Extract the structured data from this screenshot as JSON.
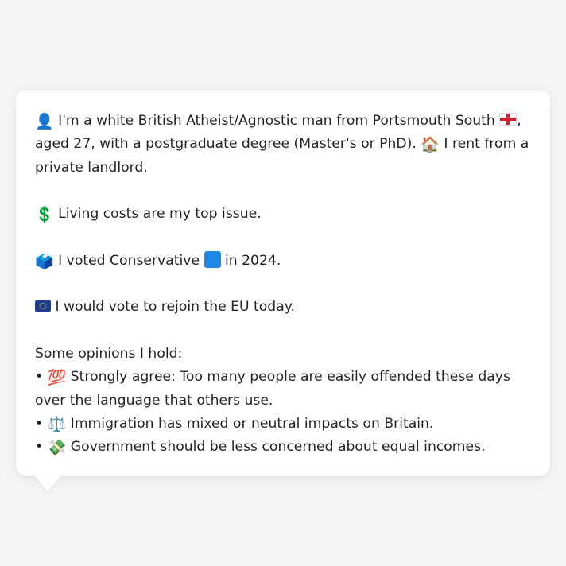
{
  "profile": {
    "line1_a": "I'm a white British Atheist/Agnostic man from Portsmouth South",
    "line1_b": ", aged 27, with a postgraduate degree (Master's or PhD).",
    "line1_c": "I rent from a private landlord.",
    "top_issue": "Living costs are my top issue.",
    "vote_a": "I voted Conservative",
    "vote_b": "in 2024.",
    "eu": "I would vote to rejoin the EU today.",
    "opinions_heading": "Some opinions I hold:",
    "opinions": [
      "Strongly agree: Too many people are easily offended these days over the language that others use.",
      "Immigration has mixed or neutral impacts on Britain.",
      "Government should be less concerned about equal incomes."
    ],
    "bullet": "•"
  },
  "icons": {
    "person": "bust-in-silhouette",
    "flag": "england-flag",
    "house": "house",
    "dollar": "heavy-dollar-sign",
    "ballot": "ballot-box",
    "party": "blue-square",
    "eu": "eu-flag",
    "hundred": "hundred-points",
    "scales": "balance-scale",
    "money": "money-with-wings"
  },
  "colors": {
    "background": "#f3f4f6",
    "bubble": "#ffffff",
    "text": "#1f2328",
    "party_blue": "#1e88e5"
  }
}
